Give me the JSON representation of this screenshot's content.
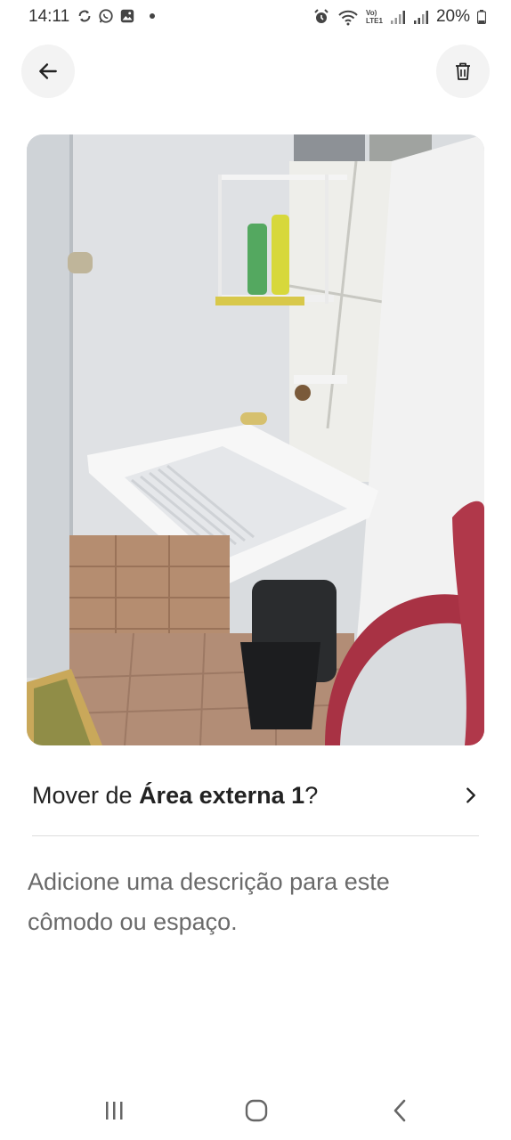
{
  "status_bar": {
    "time": "14:11",
    "left_icons": [
      "sync-icon",
      "whatsapp-icon",
      "gallery-icon",
      "notification-dot"
    ],
    "right_icons": [
      "alarm-icon",
      "wifi-icon",
      "volte-icon",
      "signal-icon",
      "signal-icon-2"
    ],
    "volte_label": "Vo)\nLTE1",
    "battery": "20%"
  },
  "header": {
    "back_icon": "arrow-left-icon",
    "delete_icon": "trash-icon"
  },
  "photo": {
    "description": "laundry-sink-photo"
  },
  "move_row": {
    "prefix": "Mover de ",
    "room": "Área externa 1",
    "suffix": "?",
    "chevron_icon": "chevron-right-icon"
  },
  "description": {
    "placeholder": "Adicione uma descrição para este cômodo ou espaço."
  },
  "nav_bar": {
    "items": [
      "recent-apps-icon",
      "home-icon",
      "back-nav-icon"
    ]
  },
  "colors": {
    "background": "#ffffff",
    "button_bg": "#f3f3f3",
    "text_primary": "#222222",
    "text_secondary": "#6a6a6a",
    "divider": "#dddddd"
  }
}
